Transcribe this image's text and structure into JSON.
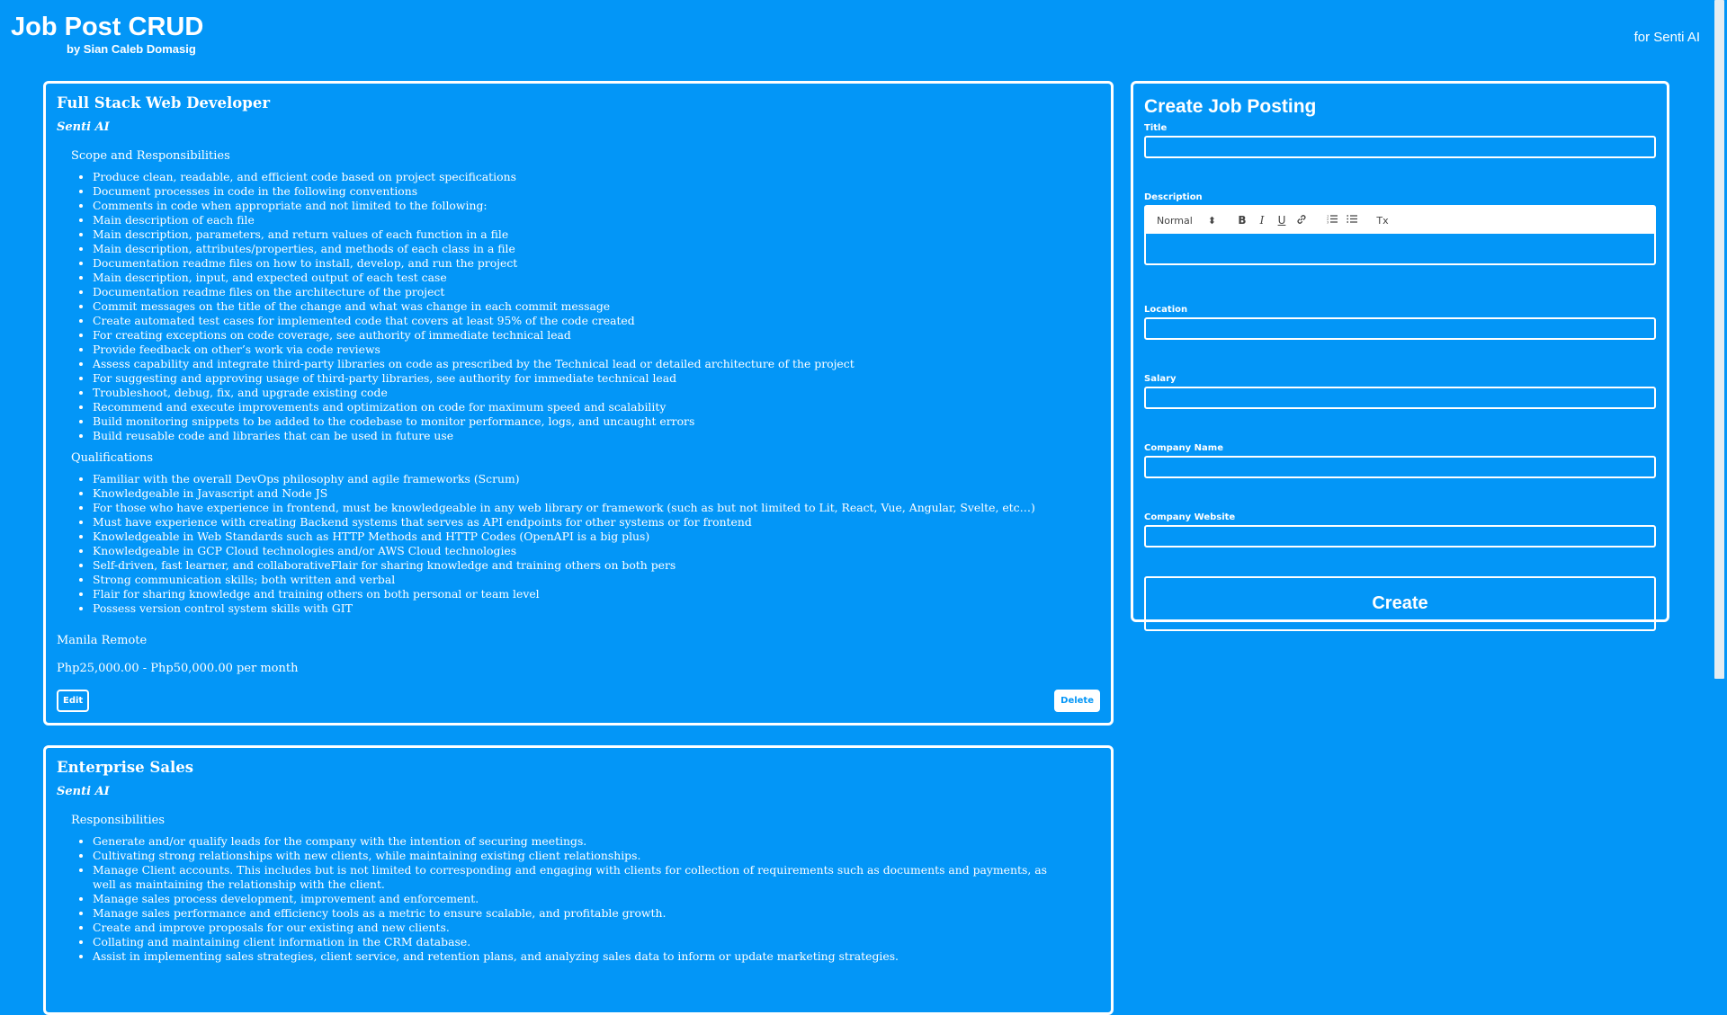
{
  "header": {
    "app_title": "Job Post CRUD",
    "author": "by Sian Caleb Domasig",
    "brand": "for Senti AI"
  },
  "jobs": [
    {
      "title": "Full Stack Web Developer",
      "company": "Senti AI",
      "sections": [
        {
          "heading": "Scope and Responsibilities",
          "items": [
            "Produce clean, readable, and efficient code based on project specifications",
            "Document processes in code in the following conventions",
            "Comments in code when appropriate and not limited to the following:",
            "Main description of each file",
            "Main description, parameters, and return values of each function in a file",
            "Main description, attributes/properties, and methods of each class in a file",
            "Documentation readme files on how to install, develop, and run the project",
            "Main description, input, and expected output of each test case",
            "Documentation readme files on the architecture of the project",
            "Commit messages on the title of the change and what was change in each commit message",
            "Create automated test cases for implemented code that covers at least 95% of the code created",
            "For creating exceptions on code coverage, see authority of immediate technical lead",
            "Provide feedback on other’s work via code reviews",
            "Assess capability and integrate third-party libraries on code as prescribed by the Technical lead or detailed architecture of the project",
            "For suggesting and approving usage of third-party libraries, see authority for immediate technical lead",
            "Troubleshoot, debug, fix, and upgrade existing code",
            "Recommend and execute improvements and optimization on code for maximum speed and scalability",
            "Build monitoring snippets to be added to the codebase to monitor performance, logs, and uncaught errors",
            "Build reusable code and libraries that can be used in future use"
          ]
        },
        {
          "heading": "Qualifications",
          "items": [
            "Familiar with the overall DevOps philosophy and agile frameworks (Scrum)",
            "Knowledgeable in Javascript and Node JS",
            "For those who have experience in frontend, must be knowledgeable in any web library or framework (such as but not limited to Lit, React, Vue, Angular, Svelte, etc…)",
            "Must have experience with creating Backend systems that serves as API endpoints for other systems or for frontend",
            "Knowledgeable in Web Standards such as HTTP Methods and HTTP Codes (OpenAPI is a big plus)",
            "Knowledgeable in GCP Cloud technologies and/or AWS Cloud technologies",
            "Self-driven, fast learner, and collaborativeFlair for sharing knowledge and training others on both pers",
            "Strong communication skills; both written and verbal",
            "Flair for sharing knowledge and training others on both personal or team level",
            "Possess version control system skills with GIT"
          ]
        }
      ],
      "location": "Manila Remote",
      "salary": "Php25,000.00 - Php50,000.00 per month",
      "edit_label": "Edit",
      "delete_label": "Delete"
    },
    {
      "title": "Enterprise Sales",
      "company": "Senti AI",
      "sections": [
        {
          "heading": "Responsibilities",
          "items": [
            "Generate and/or qualify leads for the company with the intention of securing meetings.",
            "Cultivating strong relationships with new clients, while maintaining existing client relationships.",
            "Manage Client accounts. This includes but is not limited to corresponding and engaging with clients for collection of requirements such as documents and payments, as well as maintaining the relationship with the client.",
            "Manage sales process development, improvement and enforcement.",
            "Manage sales performance and efficiency tools as a metric to ensure scalable, and profitable growth.",
            "Create and improve proposals for our existing and new clients.",
            "Collating and maintaining client information in the CRM database.",
            "Assist in implementing sales strategies, client service, and retention plans, and analyzing sales data to inform or update marketing strategies."
          ]
        }
      ]
    }
  ],
  "form": {
    "heading": "Create Job Posting",
    "title_label": "Title",
    "description_label": "Description",
    "toolbar": {
      "format_select": "Normal",
      "select_arrows": "⬍",
      "bold": "B",
      "italic": "I",
      "underline": "U",
      "link": "🔗",
      "ordered_list": "☰",
      "bullet_list": "☷",
      "clear_format": "Tx"
    },
    "location_label": "Location",
    "salary_label": "Salary",
    "company_name_label": "Company Name",
    "company_website_label": "Company Website",
    "submit_label": "Create"
  },
  "colors": {
    "background": "#0396f7",
    "foreground": "#ffffff"
  }
}
